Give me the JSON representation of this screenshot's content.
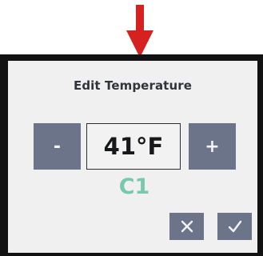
{
  "dialog": {
    "title": "Edit Temperature",
    "temperature_value": "41°F",
    "channel_label": "C1",
    "decrement_label": "-",
    "increment_label": "+",
    "cancel_icon": "close-icon",
    "confirm_icon": "check-icon"
  },
  "colors": {
    "screen_background": "#f0f0f0",
    "button_fill": "#6c7489",
    "channel_text": "#78c9ab",
    "indicator_arrow": "#d62121",
    "bezel": "#121212"
  }
}
